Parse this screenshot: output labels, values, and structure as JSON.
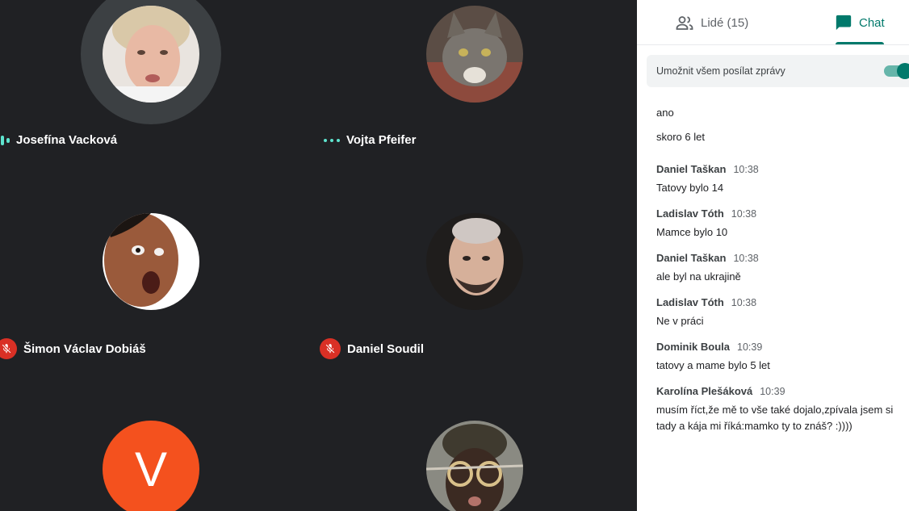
{
  "participants": [
    {
      "name": "Josefína Vacková",
      "status": "speaking"
    },
    {
      "name": "Vojta Pfeifer",
      "status": "active"
    },
    {
      "name": "Šimon Václav Dobiáš",
      "status": "muted"
    },
    {
      "name": "Daniel Soudil",
      "status": "muted"
    },
    {
      "initial": "V"
    },
    {
      "name": ""
    }
  ],
  "panel": {
    "tabs": {
      "people_label": "Lidé (15)",
      "chat_label": "Chat"
    },
    "allow_messages_label": "Umožnit všem posílat zprávy",
    "allow_messages_on": true
  },
  "chat": {
    "loose_messages": [
      "ano",
      "skoro 6 let"
    ],
    "groups": [
      {
        "sender": "Daniel Taškan",
        "time": "10:38",
        "messages": [
          "Tatovy bylo 14"
        ]
      },
      {
        "sender": "Ladislav Tóth",
        "time": "10:38",
        "messages": [
          "Mamce bylo 10"
        ]
      },
      {
        "sender": "Daniel Taškan",
        "time": "10:38",
        "messages": [
          "ale byl na ukrajině"
        ]
      },
      {
        "sender": "Ladislav Tóth",
        "time": "10:38",
        "messages": [
          "Ne v práci"
        ]
      },
      {
        "sender": "Dominik Boula",
        "time": "10:39",
        "messages": [
          "tatovy a mame bylo 5 let"
        ]
      },
      {
        "sender": "Karolína Plešáková",
        "time": "10:39",
        "messages": [
          "musím říct,že mě to vše také dojalo,zpívala jsem si tady a kája mi říká:mamko ty to znáš? :))))"
        ]
      }
    ]
  },
  "colors": {
    "accent": "#00796b",
    "mic_off": "#d93025",
    "speaking": "#5ee4cf",
    "letter_avatar": "#f4511e",
    "grid_bg": "#202124"
  },
  "icons": {
    "people": "people-icon",
    "chat": "chat-icon",
    "mic_off": "mic-off-icon"
  }
}
